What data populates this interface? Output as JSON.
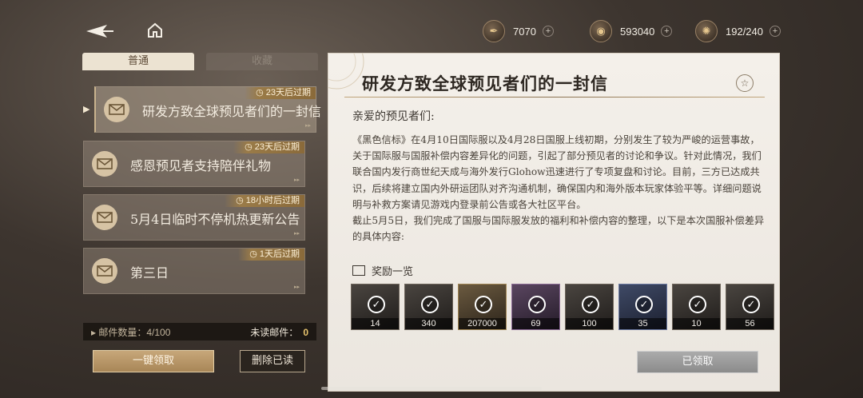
{
  "topbar": {
    "resources": [
      {
        "icon": "quill-icon",
        "value": "7070",
        "plus": "+"
      },
      {
        "icon": "coin-icon",
        "value": "593040",
        "plus": "+"
      },
      {
        "icon": "energy-orb-icon",
        "value": "192/240",
        "plus": "+"
      }
    ]
  },
  "tabs": {
    "normal": "普通",
    "favorites": "收藏"
  },
  "mails": [
    {
      "title": "研发方致全球预见者们的一封信",
      "expiry": "23天后过期"
    },
    {
      "title": "感恩预见者支持陪伴礼物",
      "expiry": "23天后过期"
    },
    {
      "title": "5月4日临时不停机热更新公告",
      "expiry": "18小时后过期"
    },
    {
      "title": "第三日",
      "expiry": "1天后过期"
    }
  ],
  "footer": {
    "mail_count_label": "邮件数量：4/100",
    "unread_label": "未读邮件：",
    "unread_value": "0",
    "claim_all": "一键领取",
    "delete_read": "删除已读"
  },
  "detail": {
    "title": "研发方致全球预见者们的一封信",
    "greeting": "亲爱的预见者们:",
    "paragraph1": "《黑色信标》在4月10日国际服以及4月28日国服上线初期，分别发生了较为严峻的运营事故，关于国际服与国服补偿内容差异化的问题，引起了部分预见者的讨论和争议。针对此情况，我们联合国内发行商世纪天成与海外发行Glohow迅速进行了专项复盘和讨论。目前，三方已达成共识，后续将建立国内外研运团队对齐沟通机制，确保国内和海外版本玩家体验平等。详细问题说明与补救方案请见游戏内登录前公告或各大社区平台。",
    "paragraph2": "截止5月5日，我们完成了国服与国际服发放的福利和补偿内容的整理，以下是本次国服补偿差异的具体内容:",
    "rewards_heading": "奖励一览",
    "rewards": [
      {
        "qty": "14",
        "rarity": "dark"
      },
      {
        "qty": "340",
        "rarity": "dark"
      },
      {
        "qty": "207000",
        "rarity": "gold"
      },
      {
        "qty": "69",
        "rarity": "purple"
      },
      {
        "qty": "100",
        "rarity": "dark"
      },
      {
        "qty": "35",
        "rarity": "blue"
      },
      {
        "qty": "10",
        "rarity": "dark"
      },
      {
        "qty": "56",
        "rarity": "dark"
      }
    ],
    "claimed_label": "已领取"
  }
}
